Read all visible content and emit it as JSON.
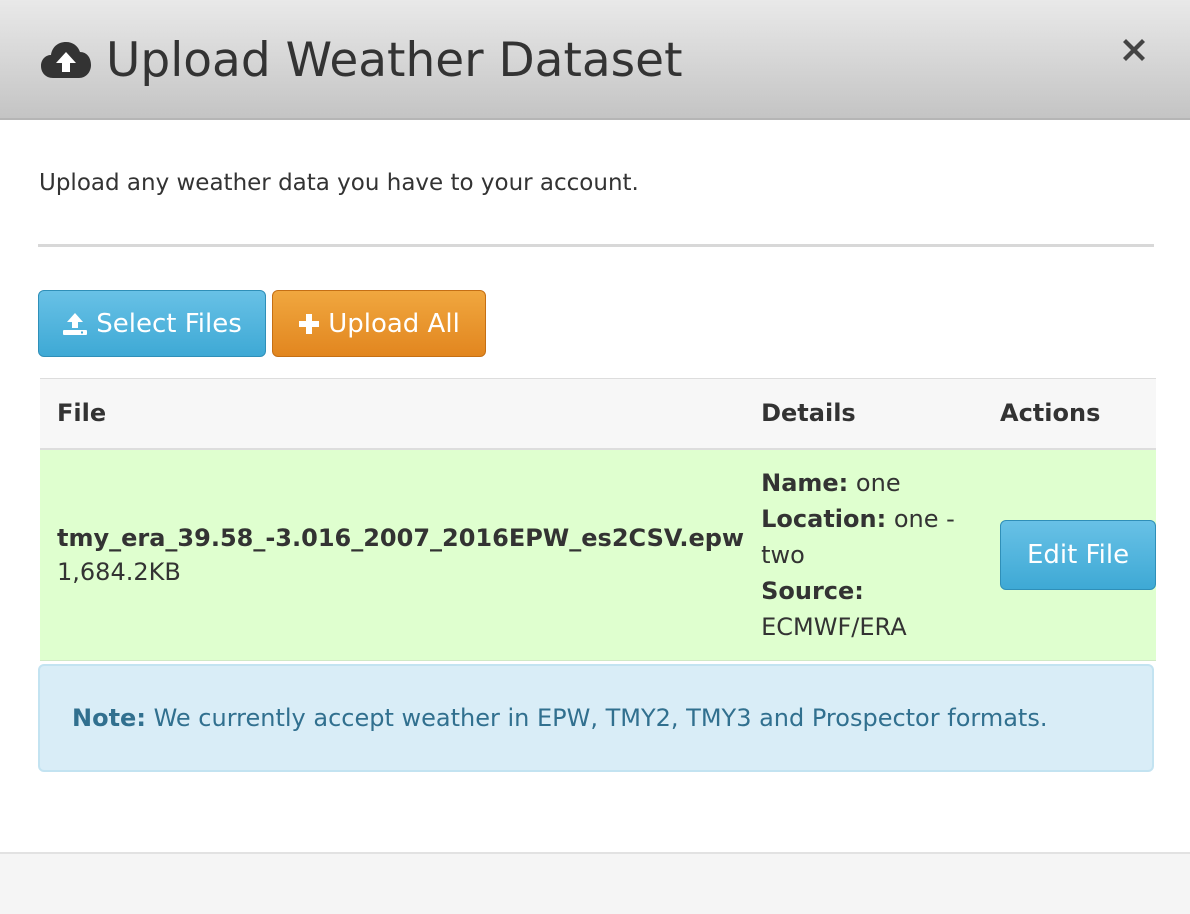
{
  "modal": {
    "title": "Upload Weather Dataset",
    "intro": "Upload any weather data you have to your account."
  },
  "toolbar": {
    "select_label": "Select Files",
    "upload_label": "Upload All"
  },
  "table": {
    "headers": [
      "File",
      "Details",
      "Actions"
    ],
    "rows": [
      {
        "file_name": "tmy_era_39.58_-3.016_2007_2016EPW_es2CSV.epw",
        "file_size": "1,684.2KB",
        "name_label": "Name:",
        "name_value": "one",
        "location_label": "Location:",
        "location_value": "one - two",
        "source_label": "Source:",
        "source_value": "ECMWF/ERA",
        "action_label": "Edit File"
      }
    ]
  },
  "note": {
    "label": "Note:",
    "text": "We currently accept weather in EPW, TMY2, TMY3 and Prospector formats."
  },
  "icons": {
    "title_icon": "cloud-upload-icon",
    "close": "close-icon",
    "select": "upload-icon",
    "upload": "plus-icon"
  },
  "colors": {
    "primary_button": "#3ea9d5",
    "warning_button": "#e2861f",
    "row_success": "#dfffcf",
    "note_bg": "#d9edf7",
    "note_text": "#31708f"
  }
}
